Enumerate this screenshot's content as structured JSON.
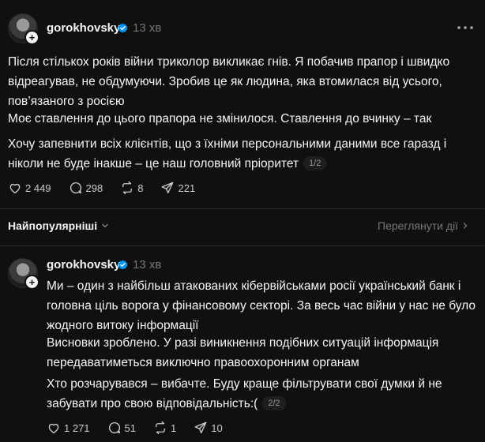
{
  "colors": {
    "background": "#101010",
    "text": "#f3f5f7",
    "muted": "#777777",
    "verified": "#0095f6"
  },
  "posts": [
    {
      "username": "gorokhovsky",
      "time": "13 хв",
      "paragraphs": [
        "Після стількох років війни триколор викликає гнів. Я побачив прапор і швидко відреагував, не обдумуючи. Зробив це як людина, яка втомилася від усього, пов’язаного з росією",
        "Моє ставлення до цього прапора не змінилося. Ставлення до вчинку – так",
        "Хочу запевнити всіх клієнтів, що з їхніми персональними даними все гаразд і ніколи не буде інакше – це наш головний пріоритет"
      ],
      "pager": "1/2",
      "likes": "2 449",
      "replies": "298",
      "reposts": "8",
      "shares": "221"
    },
    {
      "username": "gorokhovsky",
      "time": "13 хв",
      "paragraphs": [
        "Ми – один з найбільш атакованих кібервійськами росії український банк і головна ціль ворога у фінансовому секторі. За весь час війни у нас не було жодного витоку інформації",
        "Висновки зроблено. У разі виникнення подібних ситуацій інформація передаватиметься виключно правоохоронним органам",
        "Хто розчарувався – вибачте. Буду краще фільтрувати свої думки й не забувати про свою відповідальність:("
      ],
      "pager": "2/2",
      "likes": "1 271",
      "replies": "51",
      "reposts": "1",
      "shares": "10"
    }
  ],
  "sort": {
    "label": "Найпопулярніші",
    "icon": "chevron-down-icon"
  },
  "view_activity": {
    "label": "Переглянути дії",
    "icon": "chevron-right-icon"
  }
}
